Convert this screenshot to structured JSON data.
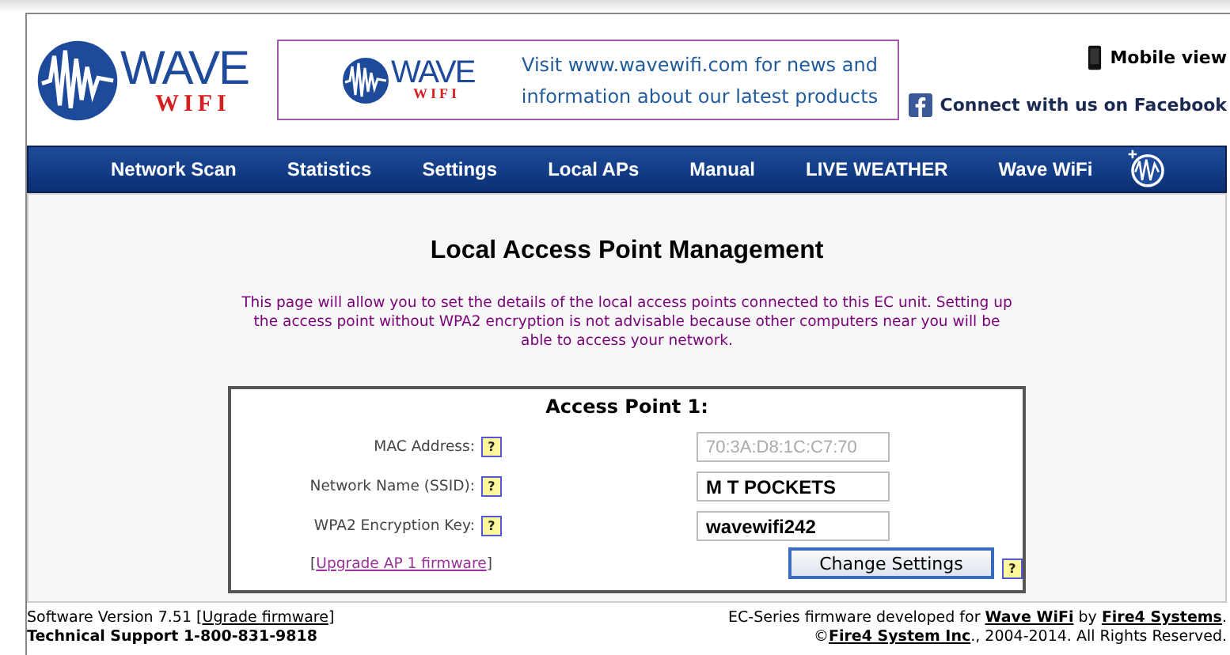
{
  "logo": {
    "word": "WAVE",
    "sub": "WIFI"
  },
  "banner": {
    "logo": {
      "word": "WAVE",
      "sub": "WIFI"
    },
    "text": "Visit www.wavewifi.com for news and information about our latest products"
  },
  "header_links": [
    {
      "kind": "mobile",
      "label": "Mobile view"
    },
    {
      "kind": "facebook",
      "label": "Connect with us on Facebook"
    }
  ],
  "nav": [
    {
      "label": "Network Scan"
    },
    {
      "label": "Statistics"
    },
    {
      "label": "Settings"
    },
    {
      "label": "Local APs"
    },
    {
      "label": "Manual"
    },
    {
      "label": "LIVE WEATHER"
    },
    {
      "label": "Wave WiFi"
    }
  ],
  "heading": "Local Access Point Management",
  "intro": "This page will allow you to set the details of the local access points connected to this EC unit. Setting up the access point without WPA2 encryption is not advisable because other computers near you will be able to access your network.",
  "access_point": {
    "title": "Access Point 1:",
    "fields": [
      {
        "label": "MAC Address:",
        "help": "?",
        "value": "70:3A:D8:1C:C7:70",
        "disabled": true
      },
      {
        "label": "Network Name (SSID):",
        "help": "?",
        "value": "M T POCKETS",
        "disabled": false
      },
      {
        "label": "WPA2 Encryption Key:",
        "help": "?",
        "value": "wavewifi242",
        "disabled": false
      }
    ],
    "upgrade": [
      {
        "t": "["
      },
      {
        "t": "Upgrade AP 1 firmware",
        "link": true
      },
      {
        "t": "]"
      }
    ],
    "button": "Change Settings",
    "help": "?"
  },
  "footer": {
    "left": [
      [
        {
          "t": "Software Version 7.51  ["
        },
        {
          "t": "Ugrade firmware",
          "link": true
        },
        {
          "t": "]"
        }
      ],
      [
        {
          "t": "Technical Support 1-800-831-9818"
        }
      ]
    ],
    "right": [
      [
        {
          "t": "EC-Series firmware developed for "
        },
        {
          "t": "Wave WiFi",
          "link": true
        },
        {
          "t": " by "
        },
        {
          "t": "Fire4 Systems",
          "link": true
        },
        {
          "t": "."
        }
      ],
      [
        {
          "t": "©"
        },
        {
          "t": "Fire4 System Inc",
          "link": true
        },
        {
          "t": "., 2004-2014. All Rights Reserved."
        }
      ]
    ]
  }
}
